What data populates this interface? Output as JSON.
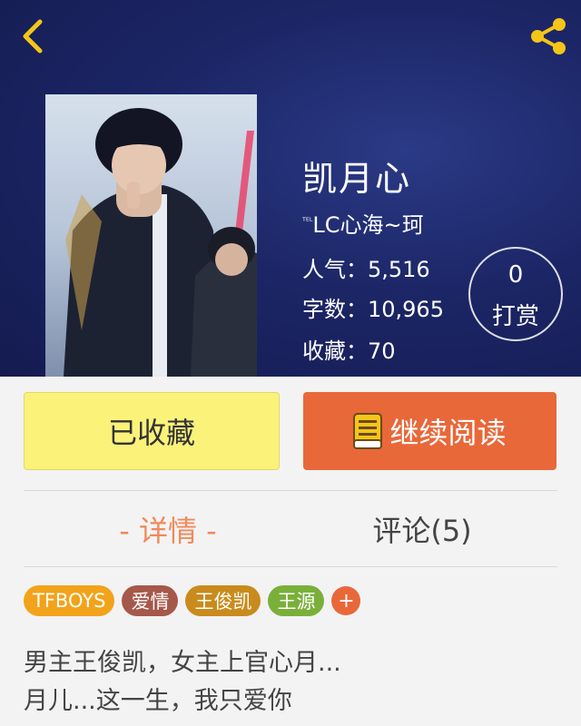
{
  "book": {
    "title": "凯月心",
    "author_prefix": "ᵀᴱᴸ",
    "author": "LC心海~珂"
  },
  "stats": {
    "popularity": "人气：5,516",
    "words": "字数：10,965",
    "favorites": "收藏：70"
  },
  "tip": {
    "count": "0",
    "label": "打赏"
  },
  "actions": {
    "collected_label": "已收藏",
    "continue_label": "继续阅读"
  },
  "tabs": {
    "detail_label": "- 详情 -",
    "comments_label": "评论(5)"
  },
  "tags": [
    {
      "label": "TFBOYS",
      "color": "#f2a31b"
    },
    {
      "label": "爱情",
      "color": "#a6584a"
    },
    {
      "label": "王俊凯",
      "color": "#c98b1c"
    },
    {
      "label": "王源",
      "color": "#7ab03a"
    }
  ],
  "tag_add_label": "+",
  "tag_add_color": "#e8683a",
  "description": {
    "line1": "男主王俊凯，女主上官心月...",
    "line2": "月儿...这一生，我只爱你"
  },
  "colors": {
    "hero_bg": "#1c2666",
    "accent_yellow": "#fbf27a",
    "accent_orange": "#e8683a",
    "icon_yellow": "#f5c518"
  }
}
